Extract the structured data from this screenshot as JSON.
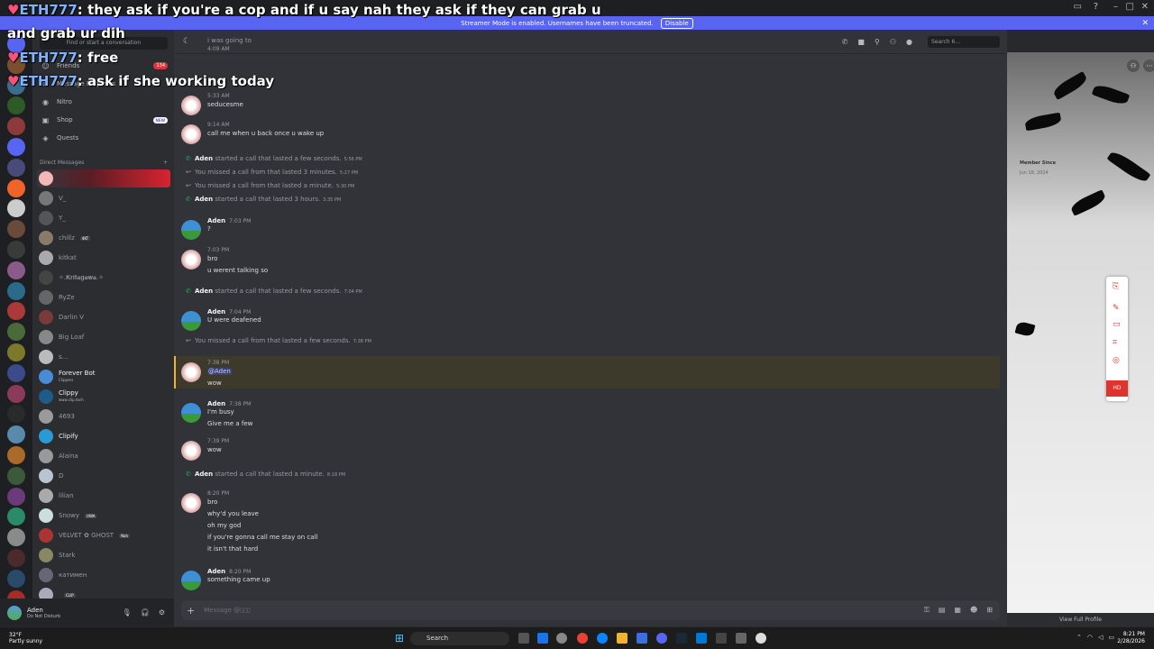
{
  "banner": {
    "text": "Streamer Mode is enabled. Usernames have been truncated.",
    "button": "Disable"
  },
  "sidebar": {
    "find_placeholder": "Find or start a conversation",
    "nav": [
      {
        "label": "Friends",
        "badge": "134"
      },
      {
        "label": "Message Requests"
      },
      {
        "label": "Nitro"
      },
      {
        "label": "Shop",
        "badge": "NEW"
      },
      {
        "label": "Quests"
      }
    ],
    "dm_header": "Direct Messages",
    "dms": [
      {
        "name": "",
        "tag": ""
      },
      {
        "name": "V_",
        "tag": ""
      },
      {
        "name": "Y_",
        "tag": ""
      },
      {
        "name": "chillz",
        "tag": "4KT"
      },
      {
        "name": "kitkat",
        "tag": ""
      },
      {
        "name": "✧.𝐊𝐫𝐢𝐭𝐚𝐠𝐚𝐰𝐚.✧",
        "tag": ""
      },
      {
        "name": "RyZe",
        "tag": ""
      },
      {
        "name": "Darlin V",
        "tag": ""
      },
      {
        "name": "Big Loaf",
        "tag": ""
      },
      {
        "name": "s...",
        "tag": ""
      },
      {
        "name": "Forever Bot",
        "sub": "Clippers"
      },
      {
        "name": "Clippy",
        "sub": "www.clip.tech"
      },
      {
        "name": "4693",
        "tag": ""
      },
      {
        "name": "Clipify",
        "tag": ""
      },
      {
        "name": "Alaina",
        "tag": ""
      },
      {
        "name": "D",
        "tag": ""
      },
      {
        "name": "lilian",
        "tag": ""
      },
      {
        "name": "Snowy",
        "tag": "UWA"
      },
      {
        "name": "VELVET ✿ GHOST",
        "tag": "Nah"
      },
      {
        "name": "Stark",
        "tag": ""
      },
      {
        "name": "катимен",
        "tag": ""
      },
      {
        "name": "",
        "tag": "CLIP"
      }
    ],
    "user": {
      "name": "Aden",
      "status": "Do Not Disturb"
    }
  },
  "header": {
    "search_placeholder": "Search 6..."
  },
  "messages": [
    {
      "time": "4:09 AM",
      "lines": [
        "i was going to"
      ]
    },
    {
      "time": "5:33 AM",
      "lines": [
        "seducesme"
      ]
    },
    {
      "time": "9:14 AM",
      "lines": [
        "call me when u back once u wake up"
      ]
    },
    {
      "sys": true,
      "who": "Aden",
      "text": "started a call that lasted a few seconds.",
      "time": "5:56 PM"
    },
    {
      "sys": true,
      "who": "",
      "text": "You missed a call from  that lasted 3 minutes.",
      "time": "5:27 PM"
    },
    {
      "sys": true,
      "who": "",
      "text": "You missed a call from  that lasted a minute.",
      "time": "5:30 PM"
    },
    {
      "sys": true,
      "who": "Aden",
      "text": "started a call that lasted 3 hours.",
      "time": "3:35 PM"
    },
    {
      "author": "Aden",
      "time": "7:03 PM",
      "lines": [
        "?"
      ]
    },
    {
      "time": "7:03 PM",
      "lines": [
        "bro",
        "u werent talking so"
      ]
    },
    {
      "sys": true,
      "who": "Aden",
      "text": "started a call that lasted a few seconds.",
      "time": "7:04 PM"
    },
    {
      "author": "Aden",
      "time": "7:04 PM",
      "lines": [
        "U were deafened"
      ]
    },
    {
      "sys": true,
      "who": "",
      "text": "You missed a call from  that lasted a few seconds.",
      "time": "7:38 PM"
    },
    {
      "time": "7:38 PM",
      "mention": "@Aden",
      "lines": [
        "wow"
      ]
    },
    {
      "author": "Aden",
      "time": "7:38 PM",
      "lines": [
        "I'm busy",
        "Give me a few"
      ]
    },
    {
      "time": "7:39 PM",
      "lines": [
        "wow"
      ]
    },
    {
      "sys": true,
      "who": "Aden",
      "text": "started a call that lasted a minute.",
      "time": "8:18 PM"
    },
    {
      "time": "8:20 PM",
      "lines": [
        "bro",
        "why'd you leave",
        "oh my god",
        "if you're gonna call me stay on call",
        "it isn't that hard"
      ]
    },
    {
      "author": "Aden",
      "time": "8:20 PM",
      "lines": [
        "something came up"
      ]
    }
  ],
  "composer": {
    "placeholder": "Message @▯▯▯"
  },
  "profile": {
    "member_since_label": "Member Since",
    "member_since": "Jun 18, 2024",
    "view_full": "View Full Profile"
  },
  "floatbar": {
    "hd": "HD"
  },
  "overlay": [
    {
      "user": "ETH777",
      "text": ": they ask if you're a cop and if u say nah they ask if they can grab u"
    },
    {
      "user": "",
      "text": "and grab ur dih"
    },
    {
      "user": "ETH777",
      "text": ": free"
    },
    {
      "user": "ETH777",
      "text": ": ask if she working today"
    }
  ],
  "taskbar": {
    "temp": "32°F",
    "weather": "Partly sunny",
    "search": "Search",
    "time": "8:21 PM",
    "date": "2/28/2026"
  }
}
